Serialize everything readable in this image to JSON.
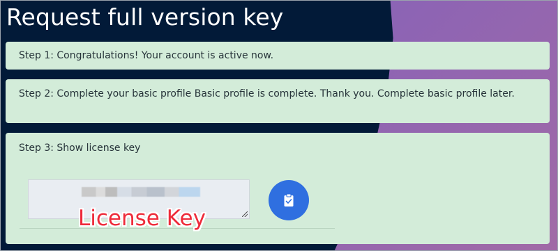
{
  "page": {
    "title": "Request full version key"
  },
  "steps": [
    {
      "text": "Step 1: Congratulations! Your account is active now."
    },
    {
      "text": "Step 2: Complete your basic profile Basic profile is complete. Thank you. Complete basic profile later."
    },
    {
      "text": "Step 3: Show license key"
    }
  ],
  "license_key": {
    "value_hidden": true,
    "copy_icon": "clipboard-check-icon"
  },
  "annotation": {
    "label": "License Key"
  },
  "colors": {
    "background": "#021a38",
    "card": "#d3ecd9",
    "button": "#2f6fe0",
    "annotation": "#ee2b3a"
  }
}
